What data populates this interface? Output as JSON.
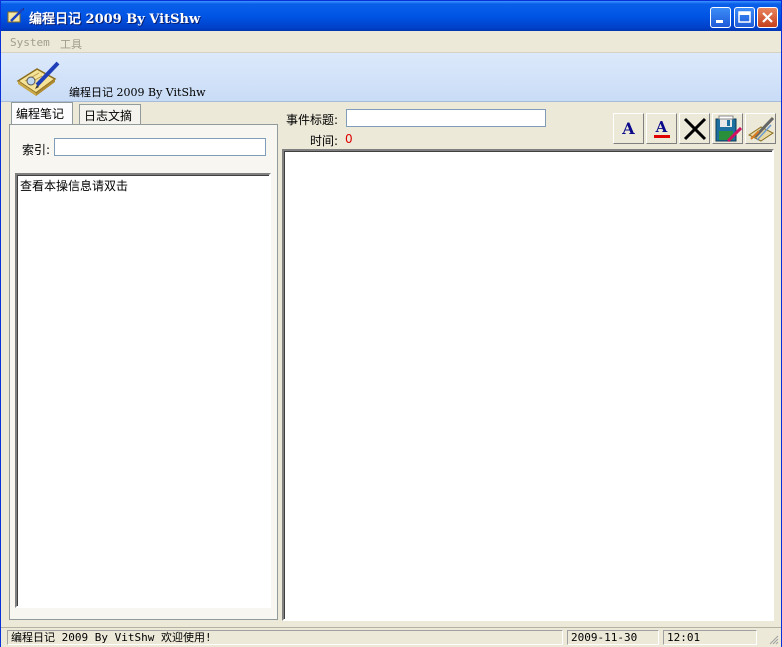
{
  "window": {
    "title": "编程日记 2009 By VitShw"
  },
  "menu": {
    "items": [
      "System",
      "工具"
    ]
  },
  "banner": {
    "text": "编程日记 2009 By VitShw"
  },
  "tabs": [
    "编程笔记",
    "日志文摘"
  ],
  "search": {
    "label": "索引:",
    "value": ""
  },
  "list": {
    "items": [
      "查看本操信息请双击"
    ]
  },
  "entry": {
    "title_label": "事件标题:",
    "title_value": "",
    "time_label": "时间:",
    "time_value": "0"
  },
  "toolbar": {
    "font_button": "A",
    "color_button": "A"
  },
  "colors": {
    "accent": "#0055e5",
    "time_value": "#e00000",
    "font_color_bar": "#e00000",
    "icon_blue": "#0a0a8a"
  },
  "icons": [
    "app-icon",
    "minimize-icon",
    "maximize-icon",
    "close-icon",
    "notebook-icon",
    "font-icon",
    "font-color-icon",
    "delete-icon",
    "save-icon",
    "edit-icon",
    "resize-grip-icon"
  ],
  "status": {
    "message": "编程日记 2009 By VitShw 欢迎使用!",
    "date": "2009-11-30",
    "time": "12:01"
  }
}
